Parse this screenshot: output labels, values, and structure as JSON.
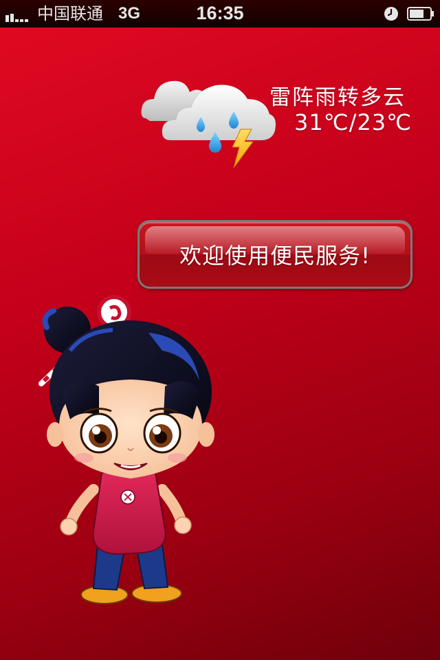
{
  "status_bar": {
    "carrier": "中国联通",
    "network": "3G",
    "time": "16:35"
  },
  "weather": {
    "description": "雷阵雨转多云",
    "temperature": "31℃/23℃",
    "icon": "thunderstorm-cloud-icon"
  },
  "welcome": {
    "label": "欢迎使用便民服务!"
  },
  "colors": {
    "background_top": "#e20a22",
    "background_bottom": "#6e000a",
    "button": "#b3101a",
    "text": "#ffffff"
  }
}
